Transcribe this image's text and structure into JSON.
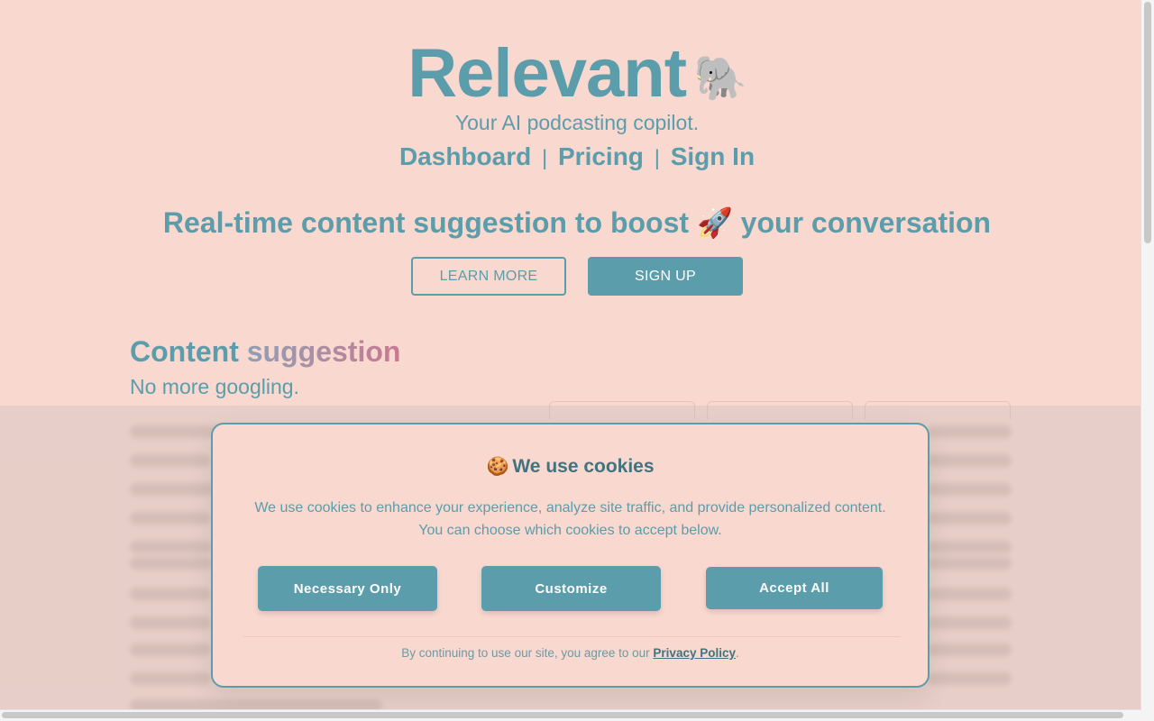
{
  "brand": {
    "name": "Relevant",
    "emoji": "🐘",
    "tagline": "Your AI podcasting copilot."
  },
  "nav": {
    "items": [
      "Dashboard",
      "Pricing",
      "Sign In"
    ],
    "separator": "|"
  },
  "hero": {
    "headline": "Real-time content suggestion to boost 🚀 your conversation",
    "learn_more": "LEARN MORE",
    "sign_up": "SIGN UP"
  },
  "section": {
    "title_part1": "Content",
    "title_part2": "suggestion",
    "subtitle": "No more googling."
  },
  "cookie_modal": {
    "emoji": "🍪",
    "title": "We use cookies",
    "text_line1": "We use cookies to enhance your experience, analyze site traffic, and provide personalized content.",
    "text_line2": "You can choose which cookies to accept below.",
    "buttons": {
      "necessary": "Necessary Only",
      "customize": "Customize",
      "accept": "Accept All"
    },
    "footer_text": "By continuing to use our site, you agree to our",
    "footer_link": "Privacy Policy",
    "footer_end": "."
  },
  "colors": {
    "background": "#f8d8cf",
    "accent": "#5b9dab",
    "accent_dark": "#3f7480",
    "gradient_end": "#c87a92"
  }
}
